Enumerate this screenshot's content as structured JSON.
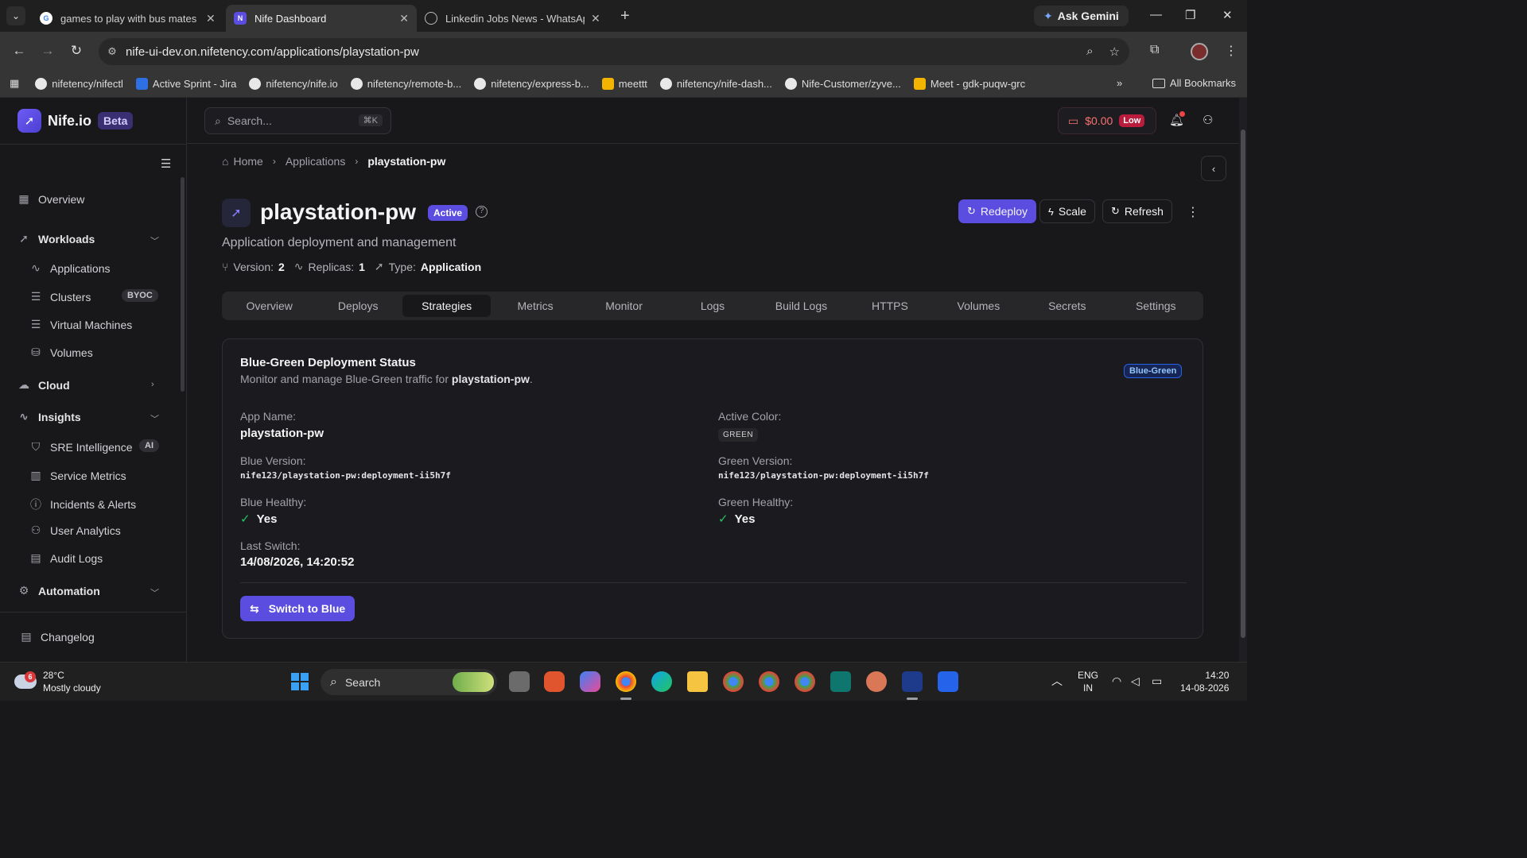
{
  "browser": {
    "tabs": [
      {
        "title": "games to play with bus mates - ",
        "active": false
      },
      {
        "title": "Nife Dashboard",
        "active": true
      },
      {
        "title": "Linkedin Jobs News - WhatsApp",
        "active": false
      }
    ],
    "gemini_label": "Ask Gemini",
    "url": "nife-ui-dev.on.nifetency.com/applications/playstation-pw",
    "bookmarks": [
      {
        "label": "nifetency/nifectl",
        "icon": "github-icon"
      },
      {
        "label": "Active Sprint - Jira",
        "icon": "jira-icon"
      },
      {
        "label": "nifetency/nife.io",
        "icon": "github-icon"
      },
      {
        "label": "nifetency/remote-b...",
        "icon": "github-icon"
      },
      {
        "label": "nifetency/express-b...",
        "icon": "github-icon"
      },
      {
        "label": "meettt",
        "icon": "meet-icon"
      },
      {
        "label": "nifetency/nife-dash...",
        "icon": "github-icon"
      },
      {
        "label": "Nife-Customer/zyve...",
        "icon": "github-icon"
      },
      {
        "label": "Meet - gdk-puqw-grc",
        "icon": "meet-icon"
      }
    ],
    "all_bookmarks": "All Bookmarks"
  },
  "brand": {
    "name": "Nife.io",
    "badge": "Beta"
  },
  "sidebar": {
    "overview": "Overview",
    "workloads": "Workloads",
    "applications": "Applications",
    "clusters": "Clusters",
    "clusters_badge": "BYOC",
    "virtual_machines": "Virtual Machines",
    "volumes": "Volumes",
    "cloud": "Cloud",
    "insights": "Insights",
    "sre_intelligence": "SRE Intelligence",
    "sre_badge": "AI",
    "service_metrics": "Service Metrics",
    "incidents_alerts": "Incidents & Alerts",
    "user_analytics": "User Analytics",
    "audit_logs": "Audit Logs",
    "automation": "Automation",
    "changelog": "Changelog"
  },
  "topbar": {
    "search_placeholder": "Search...",
    "search_shortcut": "⌘K",
    "credit": "$0.00",
    "credit_level": "Low"
  },
  "breadcrumb": {
    "home": "Home",
    "applications": "Applications",
    "current": "playstation-pw"
  },
  "app": {
    "name": "playstation-pw",
    "status": "Active",
    "subtitle": "Application deployment and management",
    "version_label": "Version:",
    "version": "2",
    "replicas_label": "Replicas:",
    "replicas": "1",
    "type_label": "Type:",
    "type": "Application"
  },
  "actions": {
    "redeploy": "Redeploy",
    "scale": "Scale",
    "refresh": "Refresh"
  },
  "tabs": [
    "Overview",
    "Deploys",
    "Strategies",
    "Metrics",
    "Monitor",
    "Logs",
    "Build Logs",
    "HTTPS",
    "Volumes",
    "Secrets",
    "Settings"
  ],
  "active_tab": "Strategies",
  "bluegreen": {
    "title": "Blue-Green Deployment Status",
    "subtitle_prefix": "Monitor and manage Blue-Green traffic for ",
    "subtitle_app": "playstation-pw",
    "subtitle_suffix": ".",
    "badge": "Blue-Green",
    "app_name_label": "App Name:",
    "app_name": "playstation-pw",
    "active_color_label": "Active Color:",
    "active_color": "GREEN",
    "blue_version_label": "Blue Version:",
    "blue_version": "nife123/playstation-pw:deployment-ii5h7f",
    "green_version_label": "Green Version:",
    "green_version": "nife123/playstation-pw:deployment-ii5h7f",
    "blue_healthy_label": "Blue Healthy:",
    "blue_healthy": "Yes",
    "green_healthy_label": "Green Healthy:",
    "green_healthy": "Yes",
    "last_switch_label": "Last Switch:",
    "last_switch": "14/08/2026, 14:20:52",
    "switch_button": "Switch to Blue"
  },
  "taskbar": {
    "weather_temp": "28°C",
    "weather_desc": "Mostly cloudy",
    "weather_badge": "6",
    "search": "Search",
    "lang_top": "ENG",
    "lang_bottom": "IN",
    "time": "14:20",
    "date": "14-08-2026"
  },
  "colors": {
    "accent": "#5b4de0",
    "danger": "#f87171",
    "success": "#22c55e",
    "badge_blue": "#93c5fd"
  }
}
